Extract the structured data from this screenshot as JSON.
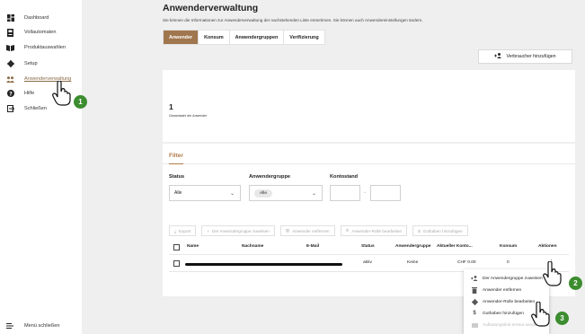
{
  "sidebar": {
    "items": [
      {
        "label": "Dashboard",
        "icon": "dashboard-icon"
      },
      {
        "label": "Vollautomaten",
        "icon": "vending-machine-icon"
      },
      {
        "label": "Produktauswahlen",
        "icon": "book-icon"
      },
      {
        "label": "Setup",
        "icon": "gear-icon"
      },
      {
        "label": "Anwenderverwaltung",
        "icon": "users-icon"
      },
      {
        "label": "Hilfe",
        "icon": "help-icon"
      },
      {
        "label": "Schließen",
        "icon": "logout-icon"
      }
    ],
    "collapse_label": "Menü schließen"
  },
  "header": {
    "title": "Anwenderverwaltung",
    "subtitle": "Sie können die Informationen zur Anwenderverwaltung der nachstehenden Liste entnehmen. Sie können auch Anwendereinstellungen ändern."
  },
  "tabs": [
    {
      "label": "Anwender"
    },
    {
      "label": "Konsum"
    },
    {
      "label": "Anwendergruppen"
    },
    {
      "label": "Verifizierung"
    }
  ],
  "add_consumer_label": "Verbraucher hinzufügen",
  "stats": {
    "count": "1",
    "label": "Gesamtzahl der Anwender"
  },
  "filter": {
    "title": "Filter",
    "status_label": "Status",
    "status_value": "Alle",
    "group_label": "Anwendergruppe",
    "group_value": "Alle",
    "balance_label": "Kontostand",
    "range_separator": "→"
  },
  "toolbar": {
    "export": "Export",
    "assign_group": "Der Anwendergruppe zuweisen",
    "remove_user": "Anwender entfernen",
    "edit_role": "Anwender-Rolle bearbeiten",
    "add_credit": "Guthaben hinzufügen"
  },
  "table": {
    "headers": {
      "name": "Name",
      "lastname": "Nachname",
      "email": "E-Mail",
      "status": "Status",
      "group": "Anwendergruppe",
      "balance": "Aktueller Konto...",
      "consumption": "Konsum",
      "actions": "Aktionen"
    },
    "rows": [
      {
        "status": "aktiv",
        "group": "Keine",
        "balance": "CHF 0.00",
        "consumption": "0",
        "actions": "⋮"
      }
    ]
  },
  "menu": {
    "items": [
      {
        "label": "Der Anwendergruppe zuweisen"
      },
      {
        "label": "Anwender entfernen"
      },
      {
        "label": "Anwender-Rolle bearbeiten"
      },
      {
        "label": "Guthaben hinzufügen"
      },
      {
        "label": "Aufladungslink erneut senden"
      }
    ]
  },
  "annotations": {
    "step1": "1",
    "step2": "2",
    "step3": "3"
  },
  "colors": {
    "accent": "#a0764e",
    "badge": "#3c8d2f"
  }
}
